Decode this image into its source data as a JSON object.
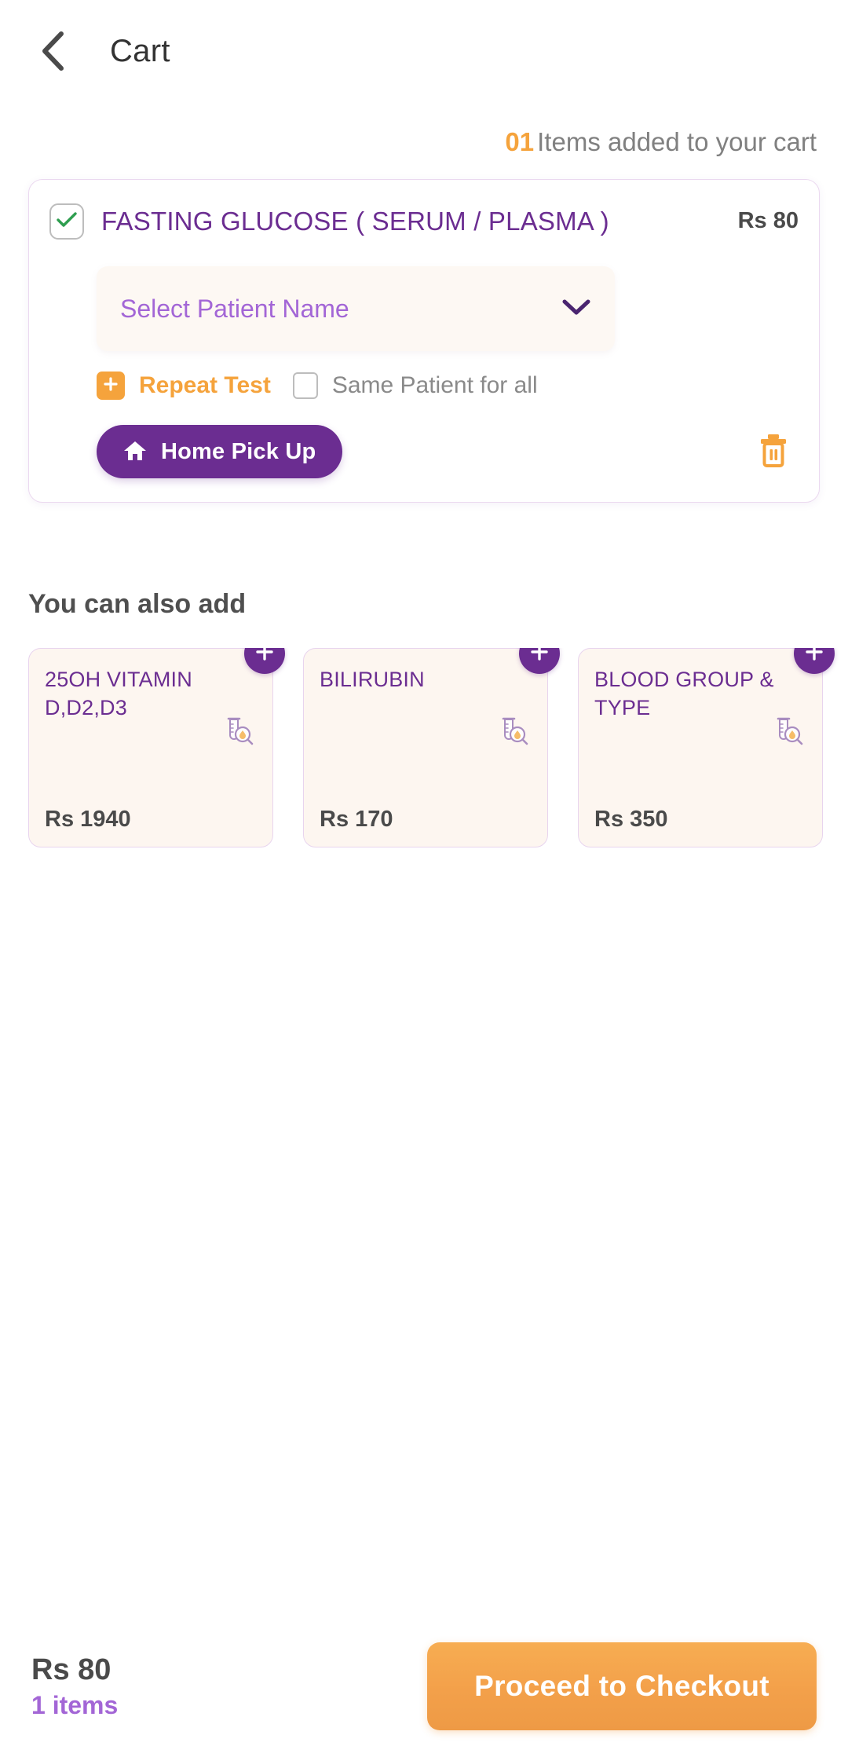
{
  "header": {
    "title": "Cart",
    "back_icon": "chevron-left-icon"
  },
  "cart_summary": {
    "count": "01",
    "count_text": "Items added to your cart"
  },
  "cart_items": [
    {
      "name": "FASTING GLUCOSE ( SERUM / PLASMA )",
      "price": "Rs 80",
      "selected": true,
      "patient_placeholder": "Select Patient Name",
      "repeat_label": "Repeat Test",
      "same_patient_label": "Same Patient for all",
      "same_patient_checked": false,
      "pickup_label": "Home Pick Up",
      "delete_icon": "trash-icon"
    }
  ],
  "suggestions": {
    "title": "You can also add",
    "items": [
      {
        "name": "25OH VITAMIN D,D2,D3",
        "price": "Rs 1940",
        "add_icon": "plus-icon"
      },
      {
        "name": "BILIRUBIN",
        "price": "Rs 170",
        "add_icon": "plus-icon"
      },
      {
        "name": "BLOOD GROUP & TYPE",
        "price": "Rs 350",
        "add_icon": "plus-icon"
      }
    ]
  },
  "footer": {
    "total_amount": "Rs 80",
    "total_items": "1 items",
    "checkout_label": "Proceed to Checkout"
  },
  "colors": {
    "primary_purple": "#6B2D91",
    "light_purple": "#A366D6",
    "accent_orange": "#F5A33C",
    "checkout_orange": "#F3A04A",
    "check_green": "#2E9E4F"
  }
}
